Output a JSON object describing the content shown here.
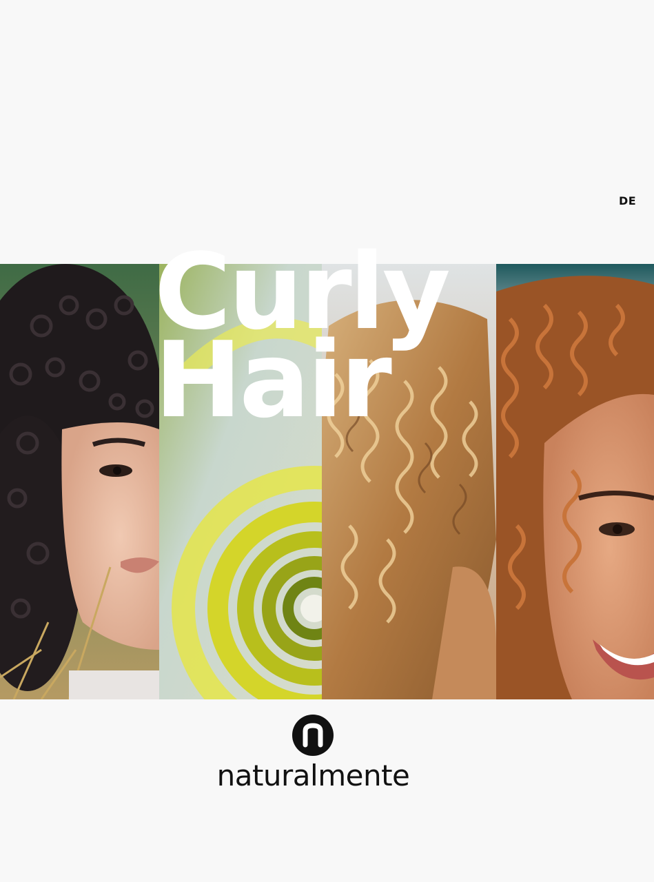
{
  "language_toggle": "DE",
  "headline": {
    "line1": "Curly",
    "line2": "Hair"
  },
  "brand": {
    "badge_letter": "n",
    "wordmark": "naturalmente"
  },
  "photos": [
    {
      "subject": "woman-dark-curly-hair"
    },
    {
      "subject": "yellow-green-spiral"
    },
    {
      "subject": "blonde-curly-hair-back"
    },
    {
      "subject": "woman-auburn-curly-hair-smiling"
    }
  ]
}
